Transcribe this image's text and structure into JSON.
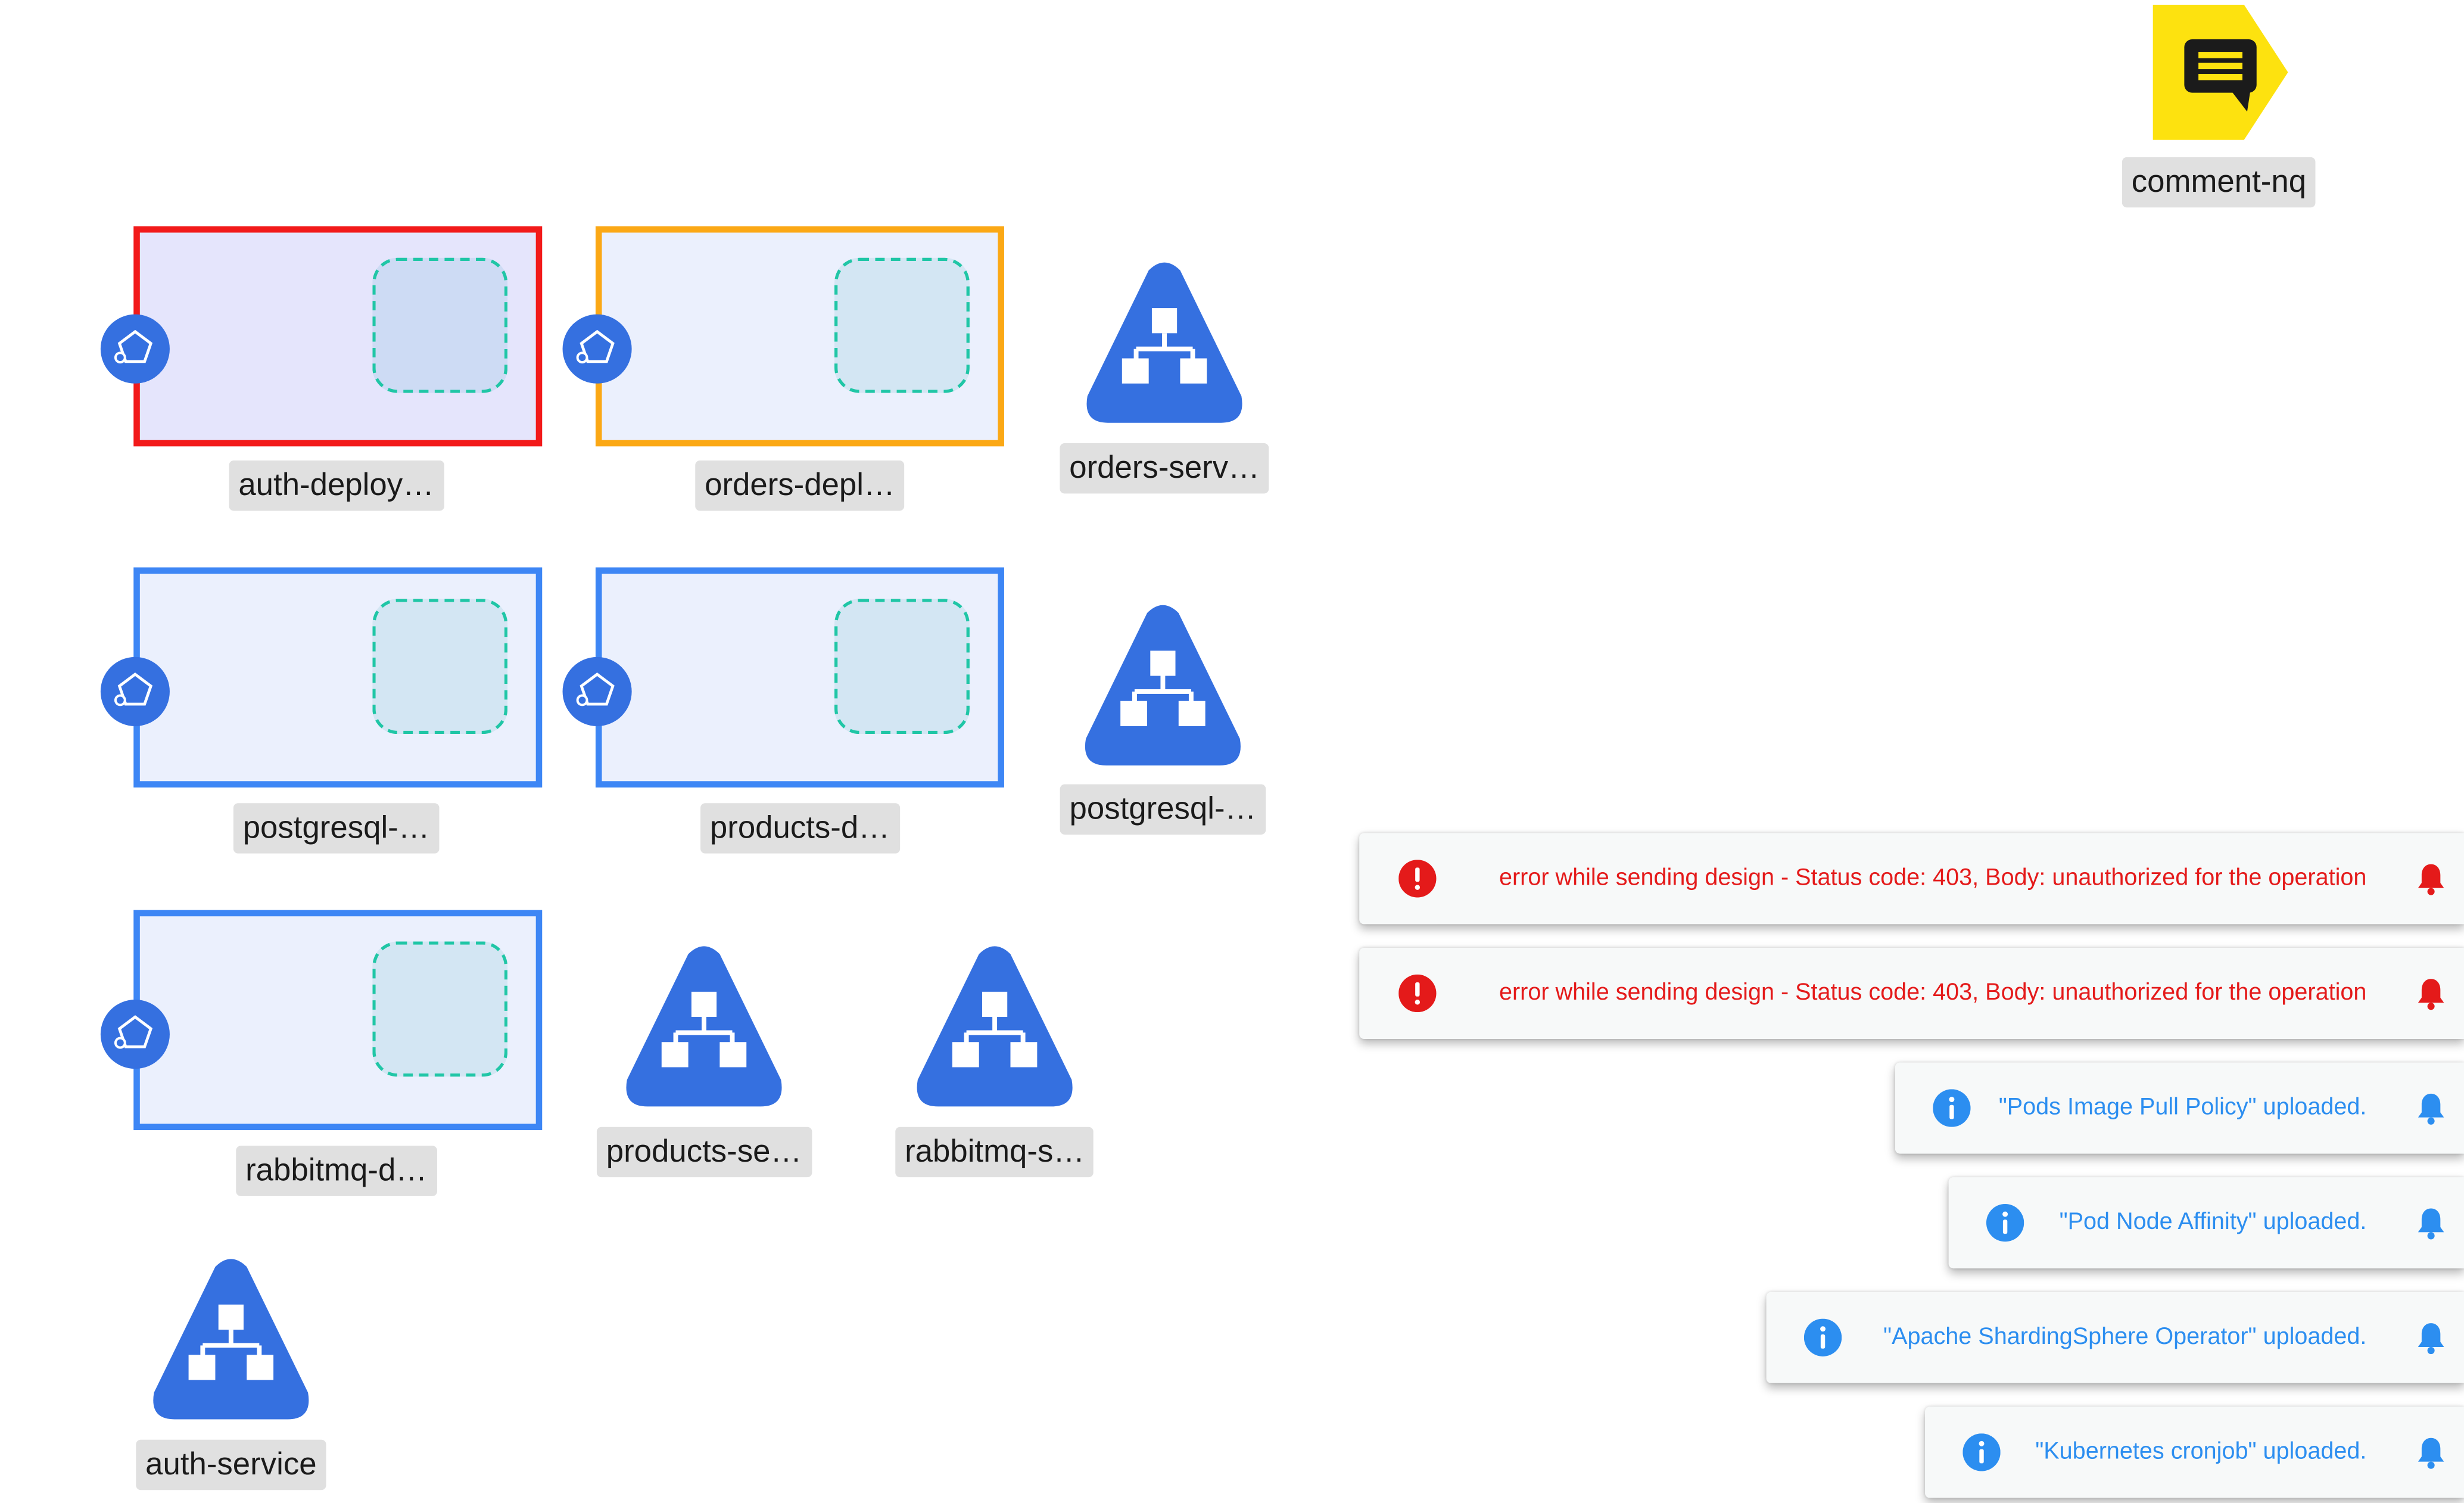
{
  "canvas": {
    "comment": {
      "label": "comment-nq",
      "icon": "comment-icon"
    },
    "deployments": [
      {
        "label": "auth-deploy…",
        "status": "error",
        "icon": "kubernetes-pentagon-icon"
      },
      {
        "label": "orders-depl…",
        "status": "warning",
        "icon": "kubernetes-pentagon-icon"
      },
      {
        "label": "postgresql-…",
        "status": "normal",
        "icon": "kubernetes-pentagon-icon"
      },
      {
        "label": "products-d…",
        "status": "normal",
        "icon": "kubernetes-pentagon-icon"
      },
      {
        "label": "rabbitmq-d…",
        "status": "normal",
        "icon": "kubernetes-pentagon-icon"
      }
    ],
    "services": [
      {
        "label": "orders-serv…",
        "icon": "service-network-icon"
      },
      {
        "label": "postgresql-…",
        "icon": "service-network-icon"
      },
      {
        "label": "products-se…",
        "icon": "service-network-icon"
      },
      {
        "label": "rabbitmq-s…",
        "icon": "service-network-icon"
      },
      {
        "label": "auth-service",
        "icon": "service-network-icon"
      }
    ]
  },
  "notifications": [
    {
      "type": "error",
      "message": "error while sending design - Status code: 403, Body: unauthorized for the operation"
    },
    {
      "type": "error",
      "message": "error while sending design - Status code: 403, Body: unauthorized for the operation"
    },
    {
      "type": "info",
      "message": "\"Pods Image Pull Policy\" uploaded."
    },
    {
      "type": "info",
      "message": "\"Pod Node Affinity\" uploaded."
    },
    {
      "type": "info",
      "message": "\"Apache ShardingSphere Operator\" uploaded."
    },
    {
      "type": "info",
      "message": "\"Kubernetes cronjob\" uploaded."
    }
  ],
  "colors": {
    "error": "#e41a1a",
    "info": "#2c8ef0",
    "service": "#3570e0",
    "comment": "#fde20f",
    "deployment_error_border": "#f21a1a",
    "deployment_warning_border": "#fba815",
    "deployment_border": "#3d86f5"
  }
}
